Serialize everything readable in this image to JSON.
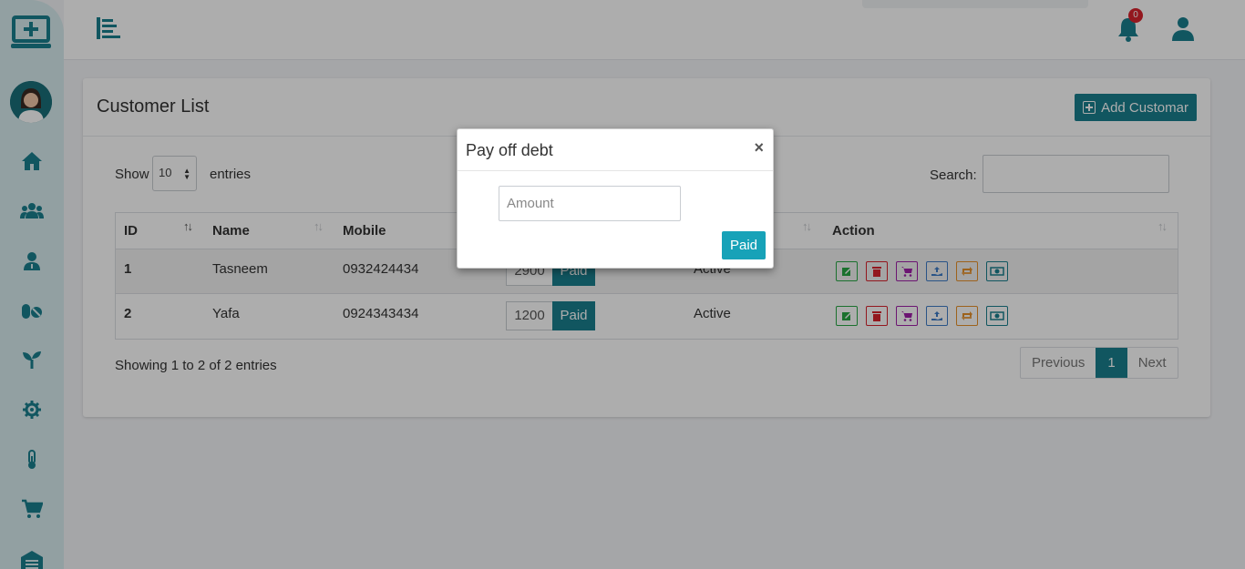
{
  "topbar": {
    "notification_count": "0"
  },
  "card": {
    "title": "Customer List",
    "add_button_label": "Add Customar"
  },
  "length_menu": {
    "show_label": "Show",
    "value": "10",
    "entries_label": "entries"
  },
  "search": {
    "label": "Search:",
    "value": ""
  },
  "table": {
    "columns": [
      "ID",
      "Name",
      "Mobile",
      "Action"
    ],
    "rows": [
      {
        "id": "1",
        "name": "Tasneem",
        "mobile": "0932424434",
        "debt": "2900",
        "pay_label": "Paid",
        "status": "Active"
      },
      {
        "id": "2",
        "name": "Yafa",
        "mobile": "0924343434",
        "debt": "1200",
        "pay_label": "Paid",
        "status": "Active"
      }
    ]
  },
  "info": "Showing 1 to 2 of 2 entries",
  "pagination": {
    "previous": "Previous",
    "current": "1",
    "next": "Next"
  },
  "modal": {
    "title": "Pay off debt",
    "close_symbol": "×",
    "amount_placeholder": "Amount",
    "submit_label": "Paid"
  },
  "sidebar": {
    "items": [
      "home-icon",
      "users-icon",
      "user-icon",
      "pills-icon",
      "seedling-icon",
      "gear-icon",
      "thermometer-icon",
      "cart-icon",
      "warehouse-icon"
    ]
  },
  "colors": {
    "primary": "#1a7f8e",
    "info": "#17a2b8",
    "danger": "#d9232d"
  }
}
